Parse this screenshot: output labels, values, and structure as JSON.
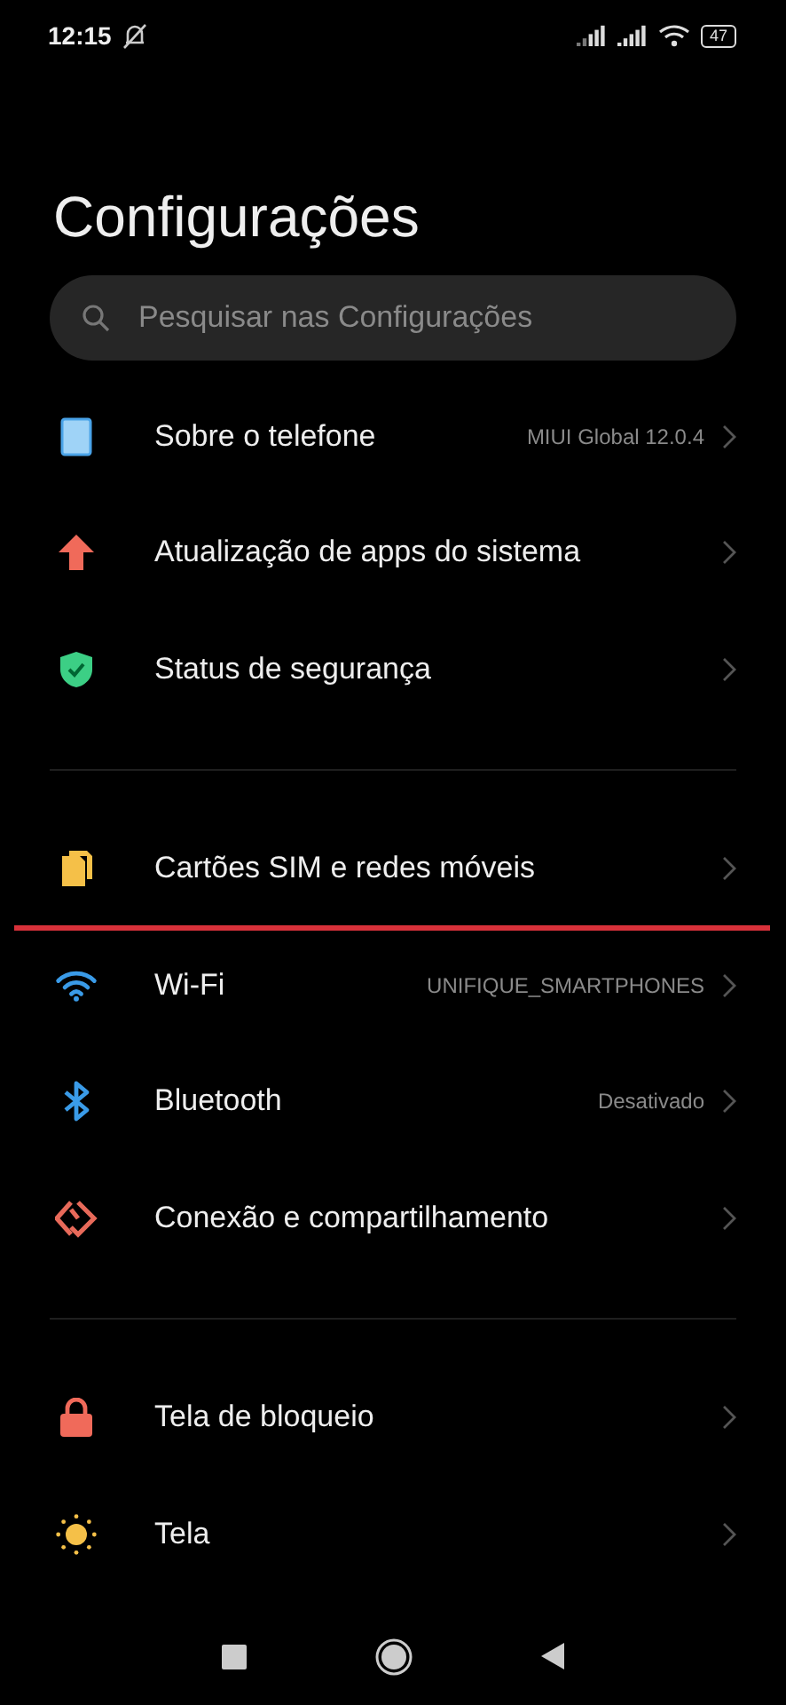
{
  "status_bar": {
    "time": "12:15",
    "battery": "47"
  },
  "title": "Configurações",
  "search": {
    "placeholder": "Pesquisar nas Configurações"
  },
  "groups": [
    {
      "items": [
        {
          "kind": "phone",
          "label": "Sobre o telefone",
          "value": "MIUI Global 12.0.4",
          "highlighted": false
        },
        {
          "kind": "update",
          "label": "Atualização de apps do sistema",
          "highlighted": false
        },
        {
          "kind": "security",
          "label": "Status de segurança",
          "highlighted": false
        }
      ]
    },
    {
      "items": [
        {
          "kind": "sim",
          "label": "Cartões SIM e redes móveis",
          "highlighted": true
        },
        {
          "kind": "wifi",
          "label": "Wi-Fi",
          "value": "UNIFIQUE_SMARTPHONES",
          "highlighted": false
        },
        {
          "kind": "bluetooth",
          "label": "Bluetooth",
          "value": "Desativado",
          "highlighted": false
        },
        {
          "kind": "share",
          "label": "Conexão e compartilhamento",
          "highlighted": false
        }
      ]
    },
    {
      "items": [
        {
          "kind": "lock",
          "label": "Tela de bloqueio",
          "highlighted": false
        },
        {
          "kind": "display",
          "label": "Tela",
          "highlighted": false
        }
      ]
    }
  ]
}
